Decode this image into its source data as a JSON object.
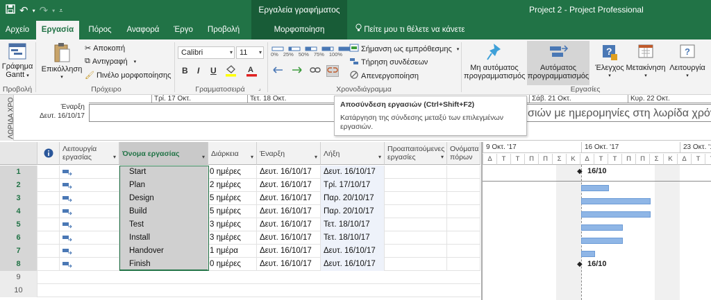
{
  "titlebar": {
    "context_tab": "Εργαλεία γραφήματος Gantt",
    "title": "Project 2  -  Project Professional"
  },
  "tabs": [
    {
      "label": "Αρχείο"
    },
    {
      "label": "Εργασία"
    },
    {
      "label": "Πόρος"
    },
    {
      "label": "Αναφορά"
    },
    {
      "label": "Έργο"
    },
    {
      "label": "Προβολή"
    },
    {
      "label": "Μορφοποίηση"
    }
  ],
  "tell_me": "Πείτε μου τι θέλετε να κάνετε",
  "ribbon": {
    "view_group": {
      "button_line1": "Γράφημα",
      "button_line2": "Gantt",
      "label": "Προβολή"
    },
    "clipboard": {
      "paste": "Επικόλληση",
      "cut": "Αποκοπή",
      "copy": "Αντιγραφή",
      "format_painter": "Πινέλο μορφοποίησης",
      "label": "Πρόχειρο"
    },
    "font": {
      "family": "Calibri",
      "size": "11",
      "label": "Γραμματοσειρά"
    },
    "schedule": {
      "percents": [
        "0%",
        "25%",
        "50%",
        "75%",
        "100%"
      ],
      "mark_on_track": "Σήμανση ως εμπρόθεσμης",
      "respect_links": "Τήρηση συνδέσεων",
      "inactivate": "Απενεργοποίηση",
      "label": "Χρονοδιάγραμμα"
    },
    "tasks": {
      "manual_line1": "Μη αυτόματος",
      "manual_line2": "προγραμματισμός",
      "auto_line1": "Αυτόματος",
      "auto_line2": "προγραμματισμός",
      "inspect": "Έλεγχος",
      "move": "Μετακίνηση",
      "mode": "Λειτουργία",
      "label": "Εργασίες"
    }
  },
  "timeline": {
    "side_label": "ΛΩΡΙΔΑ ΧΡΟ",
    "start_label": "Έναρξη",
    "start_date": "Δευτ. 16/10/17",
    "ticks": [
      "Τρί. 17 Οκτ.",
      "Τετ. 18 Οκτ.",
      "Σάβ. 21 Οκτ.",
      "Κυρ. 22 Οκτ."
    ],
    "message": "σιών με ημερομηνίες στη λωρίδα χρόνου"
  },
  "tooltip": {
    "title": "Αποσύνδεση εργασιών (Ctrl+Shift+F2)",
    "body": "Κατάργηση της σύνδεσης μεταξύ των επιλεγμένων εργασιών."
  },
  "grid": {
    "headers": {
      "mode": "Λειτουργία εργασίας",
      "name": "Όνομα εργασίας",
      "duration": "Διάρκεια",
      "start": "Έναρξη",
      "finish": "Λήξη",
      "predecessors": "Προαπαιτούμενες εργασίες",
      "resources": "Ονόματα πόρων"
    },
    "rows": [
      {
        "id": "1",
        "name": "Start",
        "duration": "0 ημέρες",
        "start": "Δευτ. 16/10/17",
        "finish": "Δευτ. 16/10/17"
      },
      {
        "id": "2",
        "name": "Plan",
        "duration": "2 ημέρες",
        "start": "Δευτ. 16/10/17",
        "finish": "Τρί. 17/10/17"
      },
      {
        "id": "3",
        "name": "Design",
        "duration": "5 ημέρες",
        "start": "Δευτ. 16/10/17",
        "finish": "Παρ. 20/10/17"
      },
      {
        "id": "4",
        "name": "Build",
        "duration": "5 ημέρες",
        "start": "Δευτ. 16/10/17",
        "finish": "Παρ. 20/10/17"
      },
      {
        "id": "5",
        "name": "Test",
        "duration": "3 ημέρες",
        "start": "Δευτ. 16/10/17",
        "finish": "Τετ. 18/10/17"
      },
      {
        "id": "6",
        "name": "Install",
        "duration": "3 ημέρες",
        "start": "Δευτ. 16/10/17",
        "finish": "Τετ. 18/10/17"
      },
      {
        "id": "7",
        "name": "Handover",
        "duration": "1 ημέρα",
        "start": "Δευτ. 16/10/17",
        "finish": "Δευτ. 16/10/17"
      },
      {
        "id": "8",
        "name": "Finish",
        "duration": "0 ημέρες",
        "start": "Δευτ. 16/10/17",
        "finish": "Δευτ. 16/10/17"
      }
    ],
    "empty_rows": [
      "9",
      "10"
    ]
  },
  "gantt": {
    "weeks": [
      "9 Οκτ. '17",
      "16 Οκτ. '17",
      "23 Οκτ. '17"
    ],
    "days": [
      "Δ",
      "Τ",
      "Τ",
      "Π",
      "Π",
      "Σ",
      "Κ",
      "Δ",
      "Τ",
      "Τ",
      "Π",
      "Π",
      "Σ",
      "Κ",
      "Δ",
      "Τ",
      "Τ"
    ],
    "milestone_start_label": "16/10",
    "milestone_finish_label": "16/10",
    "bar_days": [
      2,
      5,
      5,
      3,
      3,
      1
    ]
  },
  "colors": {
    "accent": "#217346",
    "context": "#185c37",
    "bar": "#8fb6e6"
  }
}
